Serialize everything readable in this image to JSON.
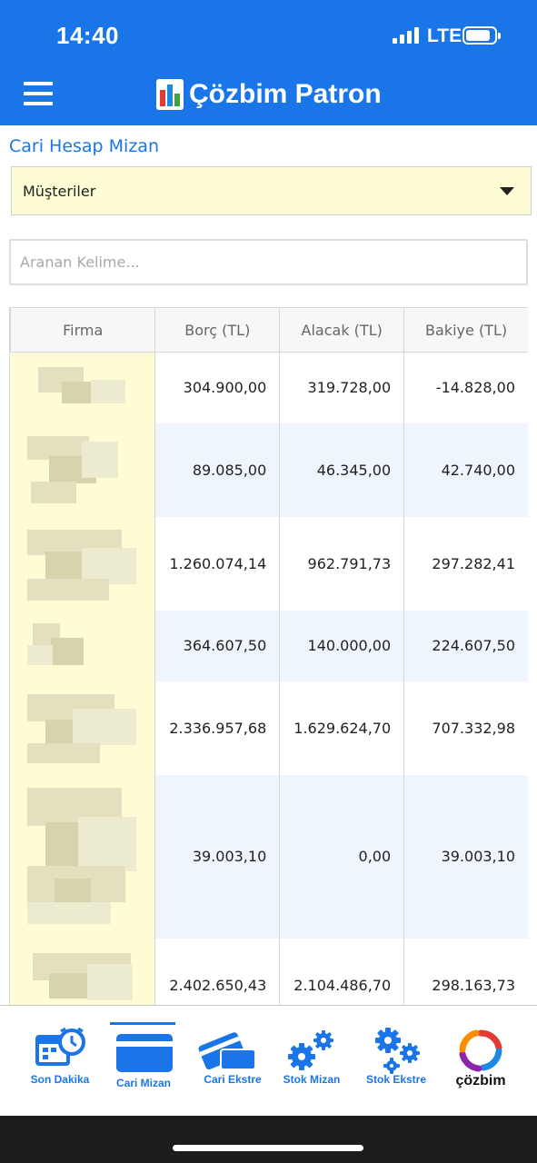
{
  "status_bar": {
    "time": "14:40",
    "network": "LTE"
  },
  "header": {
    "title": "Çözbim Patron"
  },
  "page": {
    "section_title": "Cari Hesap Mizan",
    "select_value": "Müşteriler",
    "search_placeholder": "Aranan Kelime..."
  },
  "table": {
    "headers": [
      "Firma",
      "Borç (TL)",
      "Alacak (TL)",
      "Bakiye (TL)"
    ],
    "rows": [
      {
        "borc": "304.900,00",
        "alacak": "319.728,00",
        "bakiye": "-14.828,00"
      },
      {
        "borc": "89.085,00",
        "alacak": "46.345,00",
        "bakiye": "42.740,00"
      },
      {
        "borc": "1.260.074,14",
        "alacak": "962.791,73",
        "bakiye": "297.282,41"
      },
      {
        "borc": "364.607,50",
        "alacak": "140.000,00",
        "bakiye": "224.607,50"
      },
      {
        "borc": "2.336.957,68",
        "alacak": "1.629.624,70",
        "bakiye": "707.332,98"
      },
      {
        "borc": "39.003,10",
        "alacak": "0,00",
        "bakiye": "39.003,10"
      },
      {
        "borc": "2.402.650,43",
        "alacak": "2.104.486,70",
        "bakiye": "298.163,73"
      }
    ]
  },
  "tabs": [
    {
      "label": "Son Dakika",
      "icon": "calendar-clock-icon"
    },
    {
      "label": "Cari Mizan",
      "icon": "card-icon",
      "active": true
    },
    {
      "label": "Cari Ekstre",
      "icon": "cards-icon"
    },
    {
      "label": "Stok Mizan",
      "icon": "gears-icon"
    },
    {
      "label": "Stok Ekstre",
      "icon": "gears-stack-icon"
    },
    {
      "label": "çözbim",
      "icon": "cozbim-logo"
    }
  ],
  "colors": {
    "primary": "#1a76e8",
    "highlight": "#fdfcd4",
    "row_alt": "#eef5fc"
  }
}
